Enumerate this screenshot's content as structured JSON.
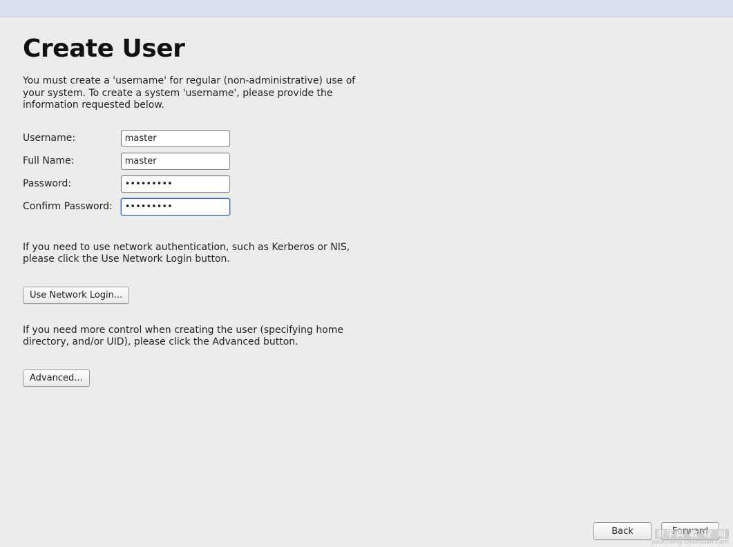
{
  "page": {
    "title": "Create User",
    "intro": "You must create a 'username' for regular (non-administrative) use of your system.  To create a system 'username', please provide the information requested below."
  },
  "form": {
    "username": {
      "label": "Username:",
      "value": "master"
    },
    "fullname": {
      "label": "Full Name:",
      "value": "master"
    },
    "password": {
      "label": "Password:",
      "value": "•••••••••"
    },
    "confirm": {
      "label": "Confirm Password:",
      "value": "•••••••••"
    }
  },
  "network": {
    "info": "If you need to use network authentication, such as Kerberos or NIS, please click the Use Network Login button.",
    "button": "Use Network Login..."
  },
  "advanced": {
    "info": "If you need more control when creating the user (specifying home directory, and/or UID), please click the Advanced button.",
    "button": "Advanced..."
  },
  "nav": {
    "back": "Back",
    "forward": "Forward"
  },
  "watermark": {
    "top": "查字典 教 程 网",
    "bottom": "jiaocheng.chazidian.com"
  }
}
